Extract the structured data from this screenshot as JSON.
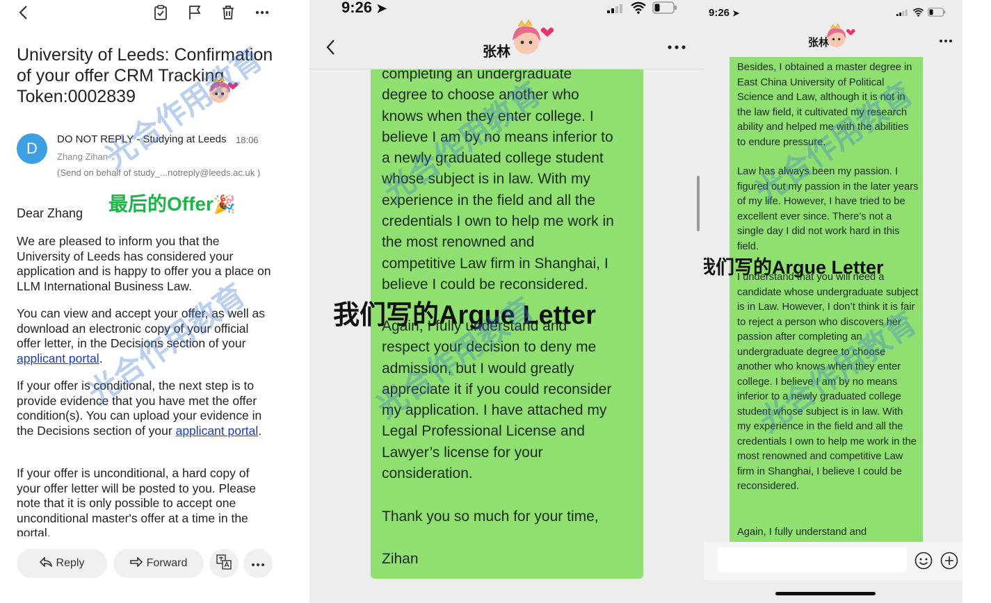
{
  "email": {
    "subject": "University of Leeds: Confirmation of your offer CRM Tracking Token:0002839",
    "sender": "DO NOT REPLY - Studying at Leeds",
    "time": "18:06",
    "to": "Zhang Zihan",
    "send_behalf": "(Send on behalf of study_...notreply@leeds.ac.uk )",
    "avatar_letter": "D",
    "greeting": "Dear Zhang",
    "offer_overlay": "最后的Offer",
    "p1": "We are pleased to inform you that the University of Leeds has considered your application and is happy to offer you a place on LLM International Business Law.",
    "p2_before": "You can view and accept your offer, as well as download an electronic copy of your official offer letter, in the Decisions section of your ",
    "p2_link": "applicant portal",
    "p2_after": ".",
    "p3_before": "If your offer is conditional, the next step is to provide evidence that you have met the offer condition(s). You can upload your evidence in the Decisions section of your ",
    "p3_link": "applicant portal",
    "p3_after": ".",
    "p4": "If your offer is unconditional, a hard copy of your offer letter will be posted to you. Please note that it is only possible to accept one unconditional master's offer at a time in the portal.",
    "reply_label": "Reply",
    "forward_label": "Forward"
  },
  "chat_large": {
    "time": "9:26",
    "contact": "张林",
    "lines": [
      "completing an undergraduate",
      "degree to choose another who",
      "knows when they enter college. I",
      "believe I am by no means inferior to",
      "a newly graduated college student",
      "whose subject is in law. With my",
      "experience in the field and all the",
      "credentials I own to help me work in",
      "the most renowned and",
      "competitive Law firm in Shanghai, I",
      "believe I could be reconsidered."
    ],
    "lines2": [
      "Again, I fully understand and",
      "respect your decision to deny me",
      "admission, but I would greatly",
      "appreciate it if you could reconsider",
      "my application.  I have attached my",
      "Legal Professional License and",
      "Lawyer’s license for your",
      "consideration."
    ],
    "thanks": "Thank you so much for your time,",
    "signature": "Zihan",
    "overlay": "我们写的Argue Letter"
  },
  "chat_small": {
    "time": "9:26",
    "contact": "张林",
    "para1": "Besides, I obtained a master degree in East China University of Political Science and Law, although it is not in the law field, it cultivated my research ability and helped me with the abilities to endure pressure.",
    "para2": "Law has always been my passion. I figured out my passion in the later years of my life. However, I have tried to be excellent ever since. There’s not a single day I did not work hard in this field.",
    "para3": "I understand that you will need a candidate whose undergraduate subject is in Law. However, I don’t think it is fair to reject a person who discovers her passion after completing an undergraduate degree to choose another who knows when they enter college. I believe I am by no means inferior to a newly graduated college student whose subject is in law. With my experience in the field and all the credentials I own to help me work in the most renowned and competitive Law firm in Shanghai, I believe I could be reconsidered.",
    "para4": "Again, I fully understand and",
    "overlay": "我们写的Argue Letter"
  },
  "watermark": "光合作用教育",
  "colors": {
    "bubble": "#8fe071",
    "offer_green": "#1fb34a",
    "avatar": "#3da0e3",
    "link": "#1a3bbd"
  }
}
